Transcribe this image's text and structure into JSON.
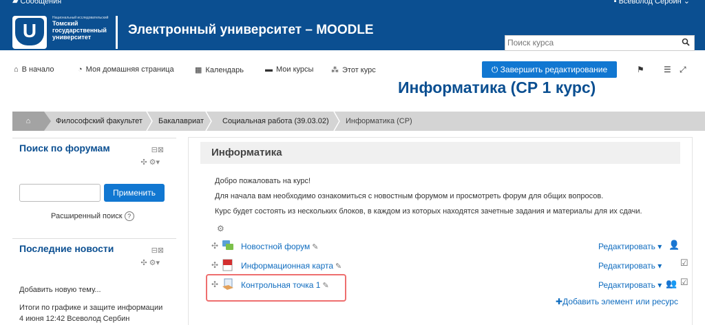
{
  "topbar": {
    "messages": "Сообщения",
    "user": "Всеволод Сербин"
  },
  "header": {
    "logo_letter": "U",
    "uni_small": "Национальный исследовательский",
    "uni_line1": "Томский",
    "uni_line2": "государственный",
    "uni_line3": "университет",
    "site_title": "Электронный университет – MOODLE",
    "search_placeholder": "Поиск курса"
  },
  "nav": {
    "items": [
      "В начало",
      "Моя домашняя страница",
      "Календарь",
      "Мои курсы",
      "Этот курс"
    ],
    "edit_button": "Завершить редактирование"
  },
  "course_title": "Информатика (СР 1 курс)",
  "breadcrumb": [
    "Философский факультет",
    "Бакалавриат",
    "Социальная работа (39.03.02)",
    "Информатика (СР)"
  ],
  "forum_search": {
    "title": "Поиск по форумам",
    "apply": "Применить",
    "advanced": "Расширенный поиск"
  },
  "news": {
    "title": "Последние новости",
    "add_topic": "Добавить новую тему...",
    "item": "Итоги по графике и защите информации",
    "meta": "4 июня 12:42  Всеволод Сербин"
  },
  "section": {
    "title": "Информатика",
    "summary": [
      "Добро пожаловать на курс!",
      "Для начала вам необходимо ознакомиться с новостным форумом и просмотреть форум для общих вопросов.",
      "Курс будет состоять из нескольких блоков, в каждом из которых находятся зачетные задания и материалы для их сдачи."
    ],
    "activities": [
      {
        "name": "Новостной форум",
        "edit": "Редактировать"
      },
      {
        "name": "Информационная карта",
        "edit": "Редактировать"
      },
      {
        "name": "Контрольная точка 1",
        "edit": "Редактировать"
      }
    ],
    "add_resource": "Добавить элемент или ресурс"
  }
}
